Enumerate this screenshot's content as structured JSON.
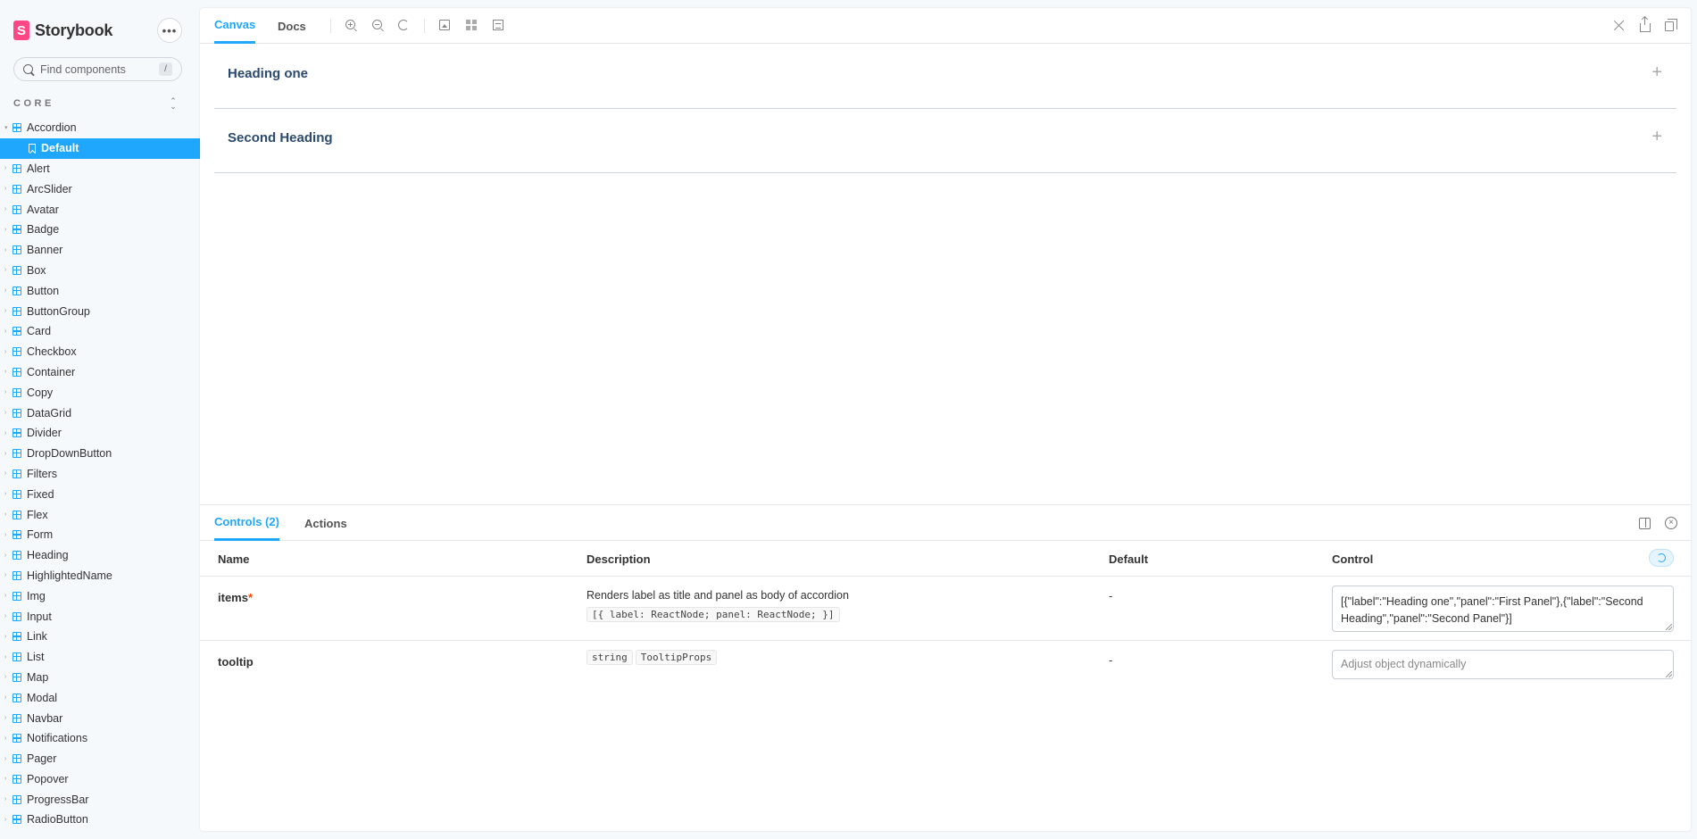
{
  "app": {
    "brand": "Storybook",
    "logo_letter": "S",
    "menu_glyph": "•••"
  },
  "search": {
    "placeholder": "Find components",
    "shortcut": "/"
  },
  "sidebar": {
    "section": "CORE",
    "expanded_component": "Accordion",
    "selected_story": "Default",
    "components": [
      "Alert",
      "ArcSlider",
      "Avatar",
      "Badge",
      "Banner",
      "Box",
      "Button",
      "ButtonGroup",
      "Card",
      "Checkbox",
      "Container",
      "Copy",
      "DataGrid",
      "Divider",
      "DropDownButton",
      "Filters",
      "Fixed",
      "Flex",
      "Form",
      "Heading",
      "HighlightedName",
      "Img",
      "Input",
      "Link",
      "List",
      "Map",
      "Modal",
      "Navbar",
      "Notifications",
      "Pager",
      "Popover",
      "ProgressBar",
      "RadioButton"
    ]
  },
  "toolbar": {
    "tabs": [
      "Canvas",
      "Docs"
    ],
    "active_tab": "Canvas"
  },
  "canvas": {
    "accordion_items": [
      {
        "title": "Heading one",
        "toggle": "+"
      },
      {
        "title": "Second Heading",
        "toggle": "+"
      }
    ]
  },
  "addons": {
    "tabs": [
      "Controls (2)",
      "Actions"
    ],
    "active_tab": "Controls (2)",
    "close_glyph": "×",
    "columns": {
      "name": "Name",
      "description": "Description",
      "default": "Default",
      "control": "Control"
    },
    "rows": [
      {
        "name": "items",
        "required_mark": "*",
        "description": "Renders label as title and panel as body of accordion",
        "types": [
          "[{ label: ReactNode; panel: ReactNode; }]"
        ],
        "default": "-",
        "control_value": "[{\"label\":\"Heading one\",\"panel\":\"First Panel\"},{\"label\":\"Second Heading\",\"panel\":\"Second Panel\"}]",
        "control_placeholder": ""
      },
      {
        "name": "tooltip",
        "required_mark": "",
        "description": "",
        "types": [
          "string",
          "TooltipProps"
        ],
        "default": "-",
        "control_value": "",
        "control_placeholder": "Adjust object dynamically"
      }
    ]
  },
  "colors": {
    "accent": "#1ea7fd",
    "brand": "#ff4785",
    "required": "#ff4400",
    "heading": "#2b4a6f"
  }
}
